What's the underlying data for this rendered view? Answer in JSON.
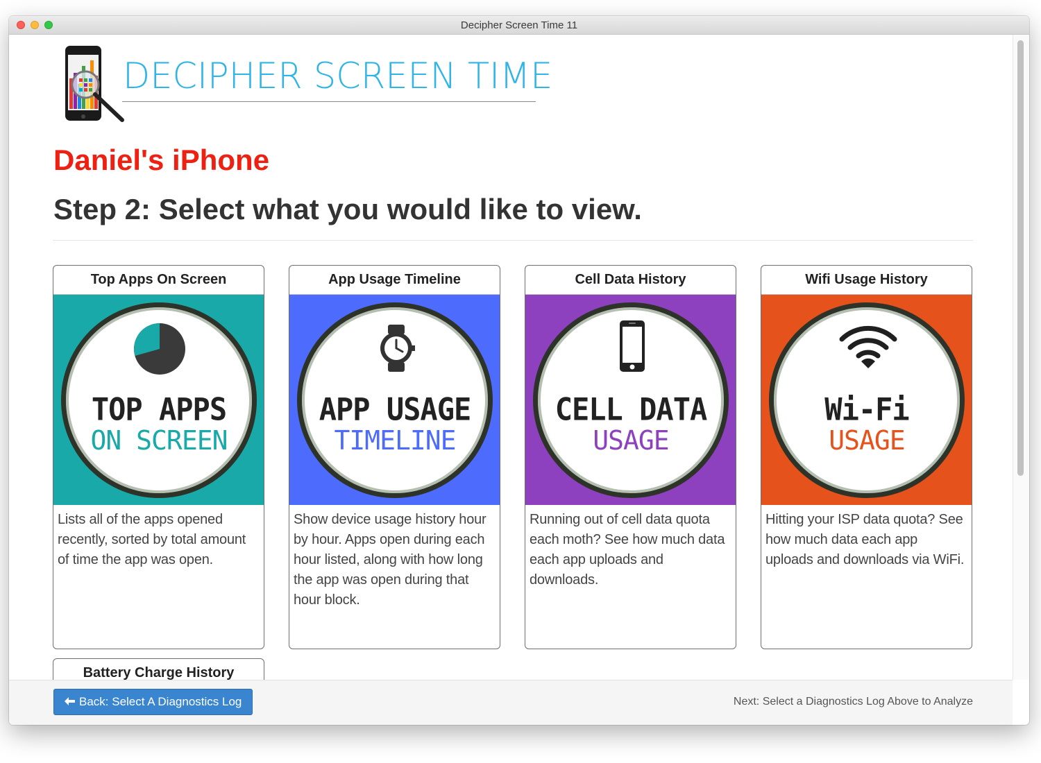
{
  "window": {
    "title": "Decipher Screen Time 11"
  },
  "brand": {
    "title": "DECIPHER SCREEN TIME"
  },
  "device_name": "Daniel's iPhone",
  "step_heading": "Step 2: Select what you would like to view.",
  "colors": {
    "brand_blue": "#2fb4e8",
    "device_red": "#ee2011",
    "teal": "#19a9a8",
    "blue": "#4d6cfd",
    "purple": "#8e41bf",
    "orange": "#e6521b",
    "button_blue": "#3a85cf"
  },
  "cards": [
    {
      "header": "Top Apps On Screen",
      "big": "TOP APPS",
      "sub": "ON SCREEN",
      "icon": "pie-chart-icon",
      "description": "Lists all of the apps opened recently, sorted by total amount of time the app was open."
    },
    {
      "header": "App Usage Timeline",
      "big": "APP USAGE",
      "sub": "TIMELINE",
      "icon": "watch-icon",
      "description": "Show device usage history hour by hour. Apps open during each hour listed, along with how long the app was open during that hour block."
    },
    {
      "header": "Cell Data History",
      "big": "CELL DATA",
      "sub": "USAGE",
      "icon": "phone-icon",
      "description": "Running out of cell data quota each moth? See how much data each app uploads and downloads."
    },
    {
      "header": "Wifi Usage History",
      "big": "Wi-Fi",
      "sub": "USAGE",
      "icon": "wifi-icon",
      "description": "Hitting your ISP data quota? See how much data each app uploads and downloads via WiFi."
    },
    {
      "header": "Battery Charge History"
    }
  ],
  "footer": {
    "back_label": "Back: Select A Diagnostics Log",
    "back_icon": "arrow-left-icon",
    "next_label": "Next: Select a Diagnostics Log Above to Analyze"
  }
}
